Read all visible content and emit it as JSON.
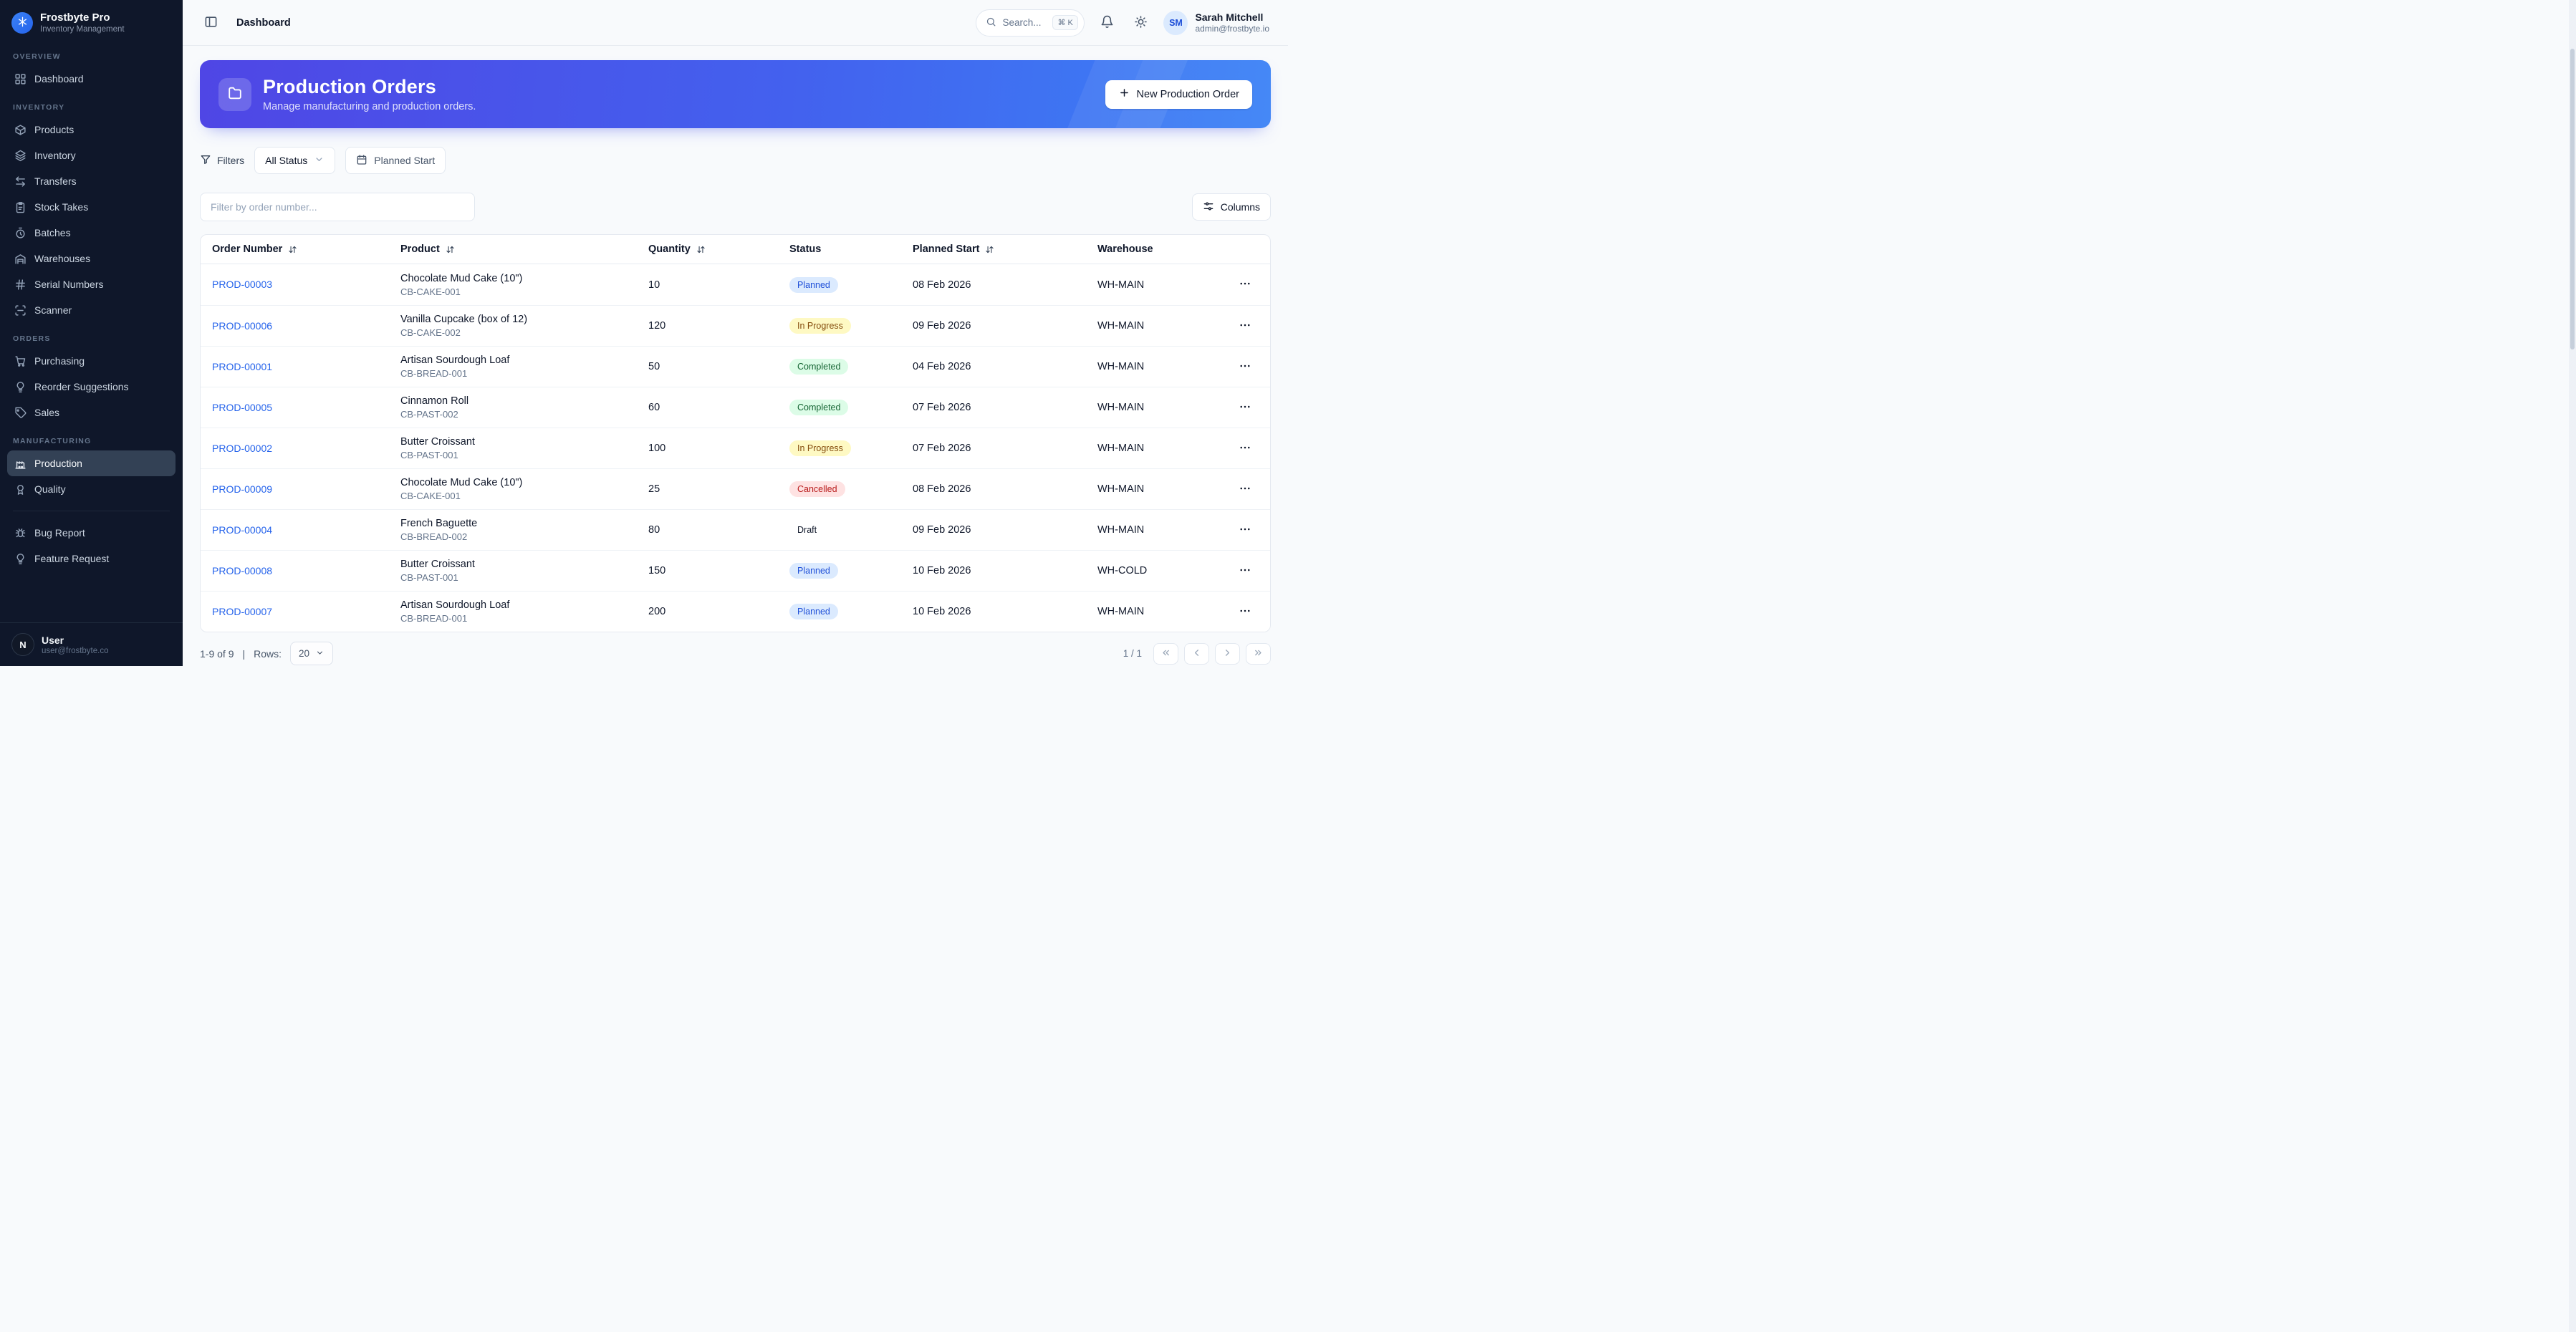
{
  "app": {
    "name": "Frostbyte Pro",
    "tagline": "Inventory Management"
  },
  "topbar": {
    "title": "Dashboard",
    "search_placeholder": "Search...",
    "search_shortcut": "⌘ K",
    "user": {
      "initials": "SM",
      "name": "Sarah Mitchell",
      "email": "admin@frostbyte.io"
    }
  },
  "sidebar": {
    "sections": [
      {
        "label": "OVERVIEW",
        "items": [
          {
            "label": "Dashboard",
            "icon": "dashboard-icon",
            "active": false
          }
        ]
      },
      {
        "label": "INVENTORY",
        "items": [
          {
            "label": "Products",
            "icon": "package-icon",
            "active": false
          },
          {
            "label": "Inventory",
            "icon": "layers-icon",
            "active": false
          },
          {
            "label": "Transfers",
            "icon": "transfers-icon",
            "active": false
          },
          {
            "label": "Stock Takes",
            "icon": "clipboard-icon",
            "active": false
          },
          {
            "label": "Batches",
            "icon": "timer-icon",
            "active": false
          },
          {
            "label": "Warehouses",
            "icon": "warehouse-icon",
            "active": false
          },
          {
            "label": "Serial Numbers",
            "icon": "hash-icon",
            "active": false
          },
          {
            "label": "Scanner",
            "icon": "scan-icon",
            "active": false
          }
        ]
      },
      {
        "label": "ORDERS",
        "items": [
          {
            "label": "Purchasing",
            "icon": "cart-icon",
            "active": false
          },
          {
            "label": "Reorder Suggestions",
            "icon": "lightbulb-icon",
            "active": false
          },
          {
            "label": "Sales",
            "icon": "tag-icon",
            "active": false
          }
        ]
      },
      {
        "label": "MANUFACTURING",
        "items": [
          {
            "label": "Production",
            "icon": "factory-icon",
            "active": true
          },
          {
            "label": "Quality",
            "icon": "award-icon",
            "active": false
          }
        ]
      }
    ],
    "footer_items": [
      {
        "label": "Bug Report",
        "icon": "bug-icon"
      },
      {
        "label": "Feature Request",
        "icon": "lightbulb-icon"
      }
    ],
    "user": {
      "initials": "N",
      "name": "User",
      "email": "user@frostbyte.co"
    }
  },
  "hero": {
    "icon": "folder-icon",
    "title": "Production Orders",
    "subtitle": "Manage manufacturing and production orders.",
    "cta": "New Production Order"
  },
  "filters": {
    "label": "Filters",
    "status_filter": "All Status",
    "date_filter": "Planned Start"
  },
  "search": {
    "placeholder": "Filter by order number..."
  },
  "columns_button": "Columns",
  "table": {
    "headers": [
      {
        "label": "Order Number",
        "sortable": true
      },
      {
        "label": "Product",
        "sortable": true
      },
      {
        "label": "Quantity",
        "sortable": true
      },
      {
        "label": "Status",
        "sortable": false
      },
      {
        "label": "Planned Start",
        "sortable": true
      },
      {
        "label": "Warehouse",
        "sortable": false
      }
    ],
    "rows": [
      {
        "order": "PROD-00003",
        "product": "Chocolate Mud Cake (10\")",
        "sku": "CB-CAKE-001",
        "qty": "10",
        "status": "Planned",
        "date": "08 Feb 2026",
        "warehouse": "WH-MAIN"
      },
      {
        "order": "PROD-00006",
        "product": "Vanilla Cupcake (box of 12)",
        "sku": "CB-CAKE-002",
        "qty": "120",
        "status": "In Progress",
        "date": "09 Feb 2026",
        "warehouse": "WH-MAIN"
      },
      {
        "order": "PROD-00001",
        "product": "Artisan Sourdough Loaf",
        "sku": "CB-BREAD-001",
        "qty": "50",
        "status": "Completed",
        "date": "04 Feb 2026",
        "warehouse": "WH-MAIN"
      },
      {
        "order": "PROD-00005",
        "product": "Cinnamon Roll",
        "sku": "CB-PAST-002",
        "qty": "60",
        "status": "Completed",
        "date": "07 Feb 2026",
        "warehouse": "WH-MAIN"
      },
      {
        "order": "PROD-00002",
        "product": "Butter Croissant",
        "sku": "CB-PAST-001",
        "qty": "100",
        "status": "In Progress",
        "date": "07 Feb 2026",
        "warehouse": "WH-MAIN"
      },
      {
        "order": "PROD-00009",
        "product": "Chocolate Mud Cake (10\")",
        "sku": "CB-CAKE-001",
        "qty": "25",
        "status": "Cancelled",
        "date": "08 Feb 2026",
        "warehouse": "WH-MAIN"
      },
      {
        "order": "PROD-00004",
        "product": "French Baguette",
        "sku": "CB-BREAD-002",
        "qty": "80",
        "status": "Draft",
        "date": "09 Feb 2026",
        "warehouse": "WH-MAIN"
      },
      {
        "order": "PROD-00008",
        "product": "Butter Croissant",
        "sku": "CB-PAST-001",
        "qty": "150",
        "status": "Planned",
        "date": "10 Feb 2026",
        "warehouse": "WH-COLD"
      },
      {
        "order": "PROD-00007",
        "product": "Artisan Sourdough Loaf",
        "sku": "CB-BREAD-001",
        "qty": "200",
        "status": "Planned",
        "date": "10 Feb 2026",
        "warehouse": "WH-MAIN"
      }
    ]
  },
  "status_colors": {
    "Planned": {
      "bg": "#dbeafe",
      "text": "#1d4ed8"
    },
    "In Progress": {
      "bg": "#fef9c3",
      "text": "#854d0e"
    },
    "Completed": {
      "bg": "#dcfce7",
      "text": "#166534"
    },
    "Cancelled": {
      "bg": "#fee2e2",
      "text": "#b91c1c"
    },
    "Draft": {
      "bg": "transparent",
      "text": "#0f172a"
    }
  },
  "pagination": {
    "range": "1-9 of 9",
    "divider": "|",
    "rows_label": "Rows:",
    "rows_per_page": "20",
    "page_indicator": "1 / 1"
  },
  "brand_colors": {
    "sidebar_bg": "#0f172a",
    "accent_blue": "#2563eb",
    "hero_gradient_start": "#4f46e5",
    "hero_gradient_end": "#3b82f6"
  }
}
